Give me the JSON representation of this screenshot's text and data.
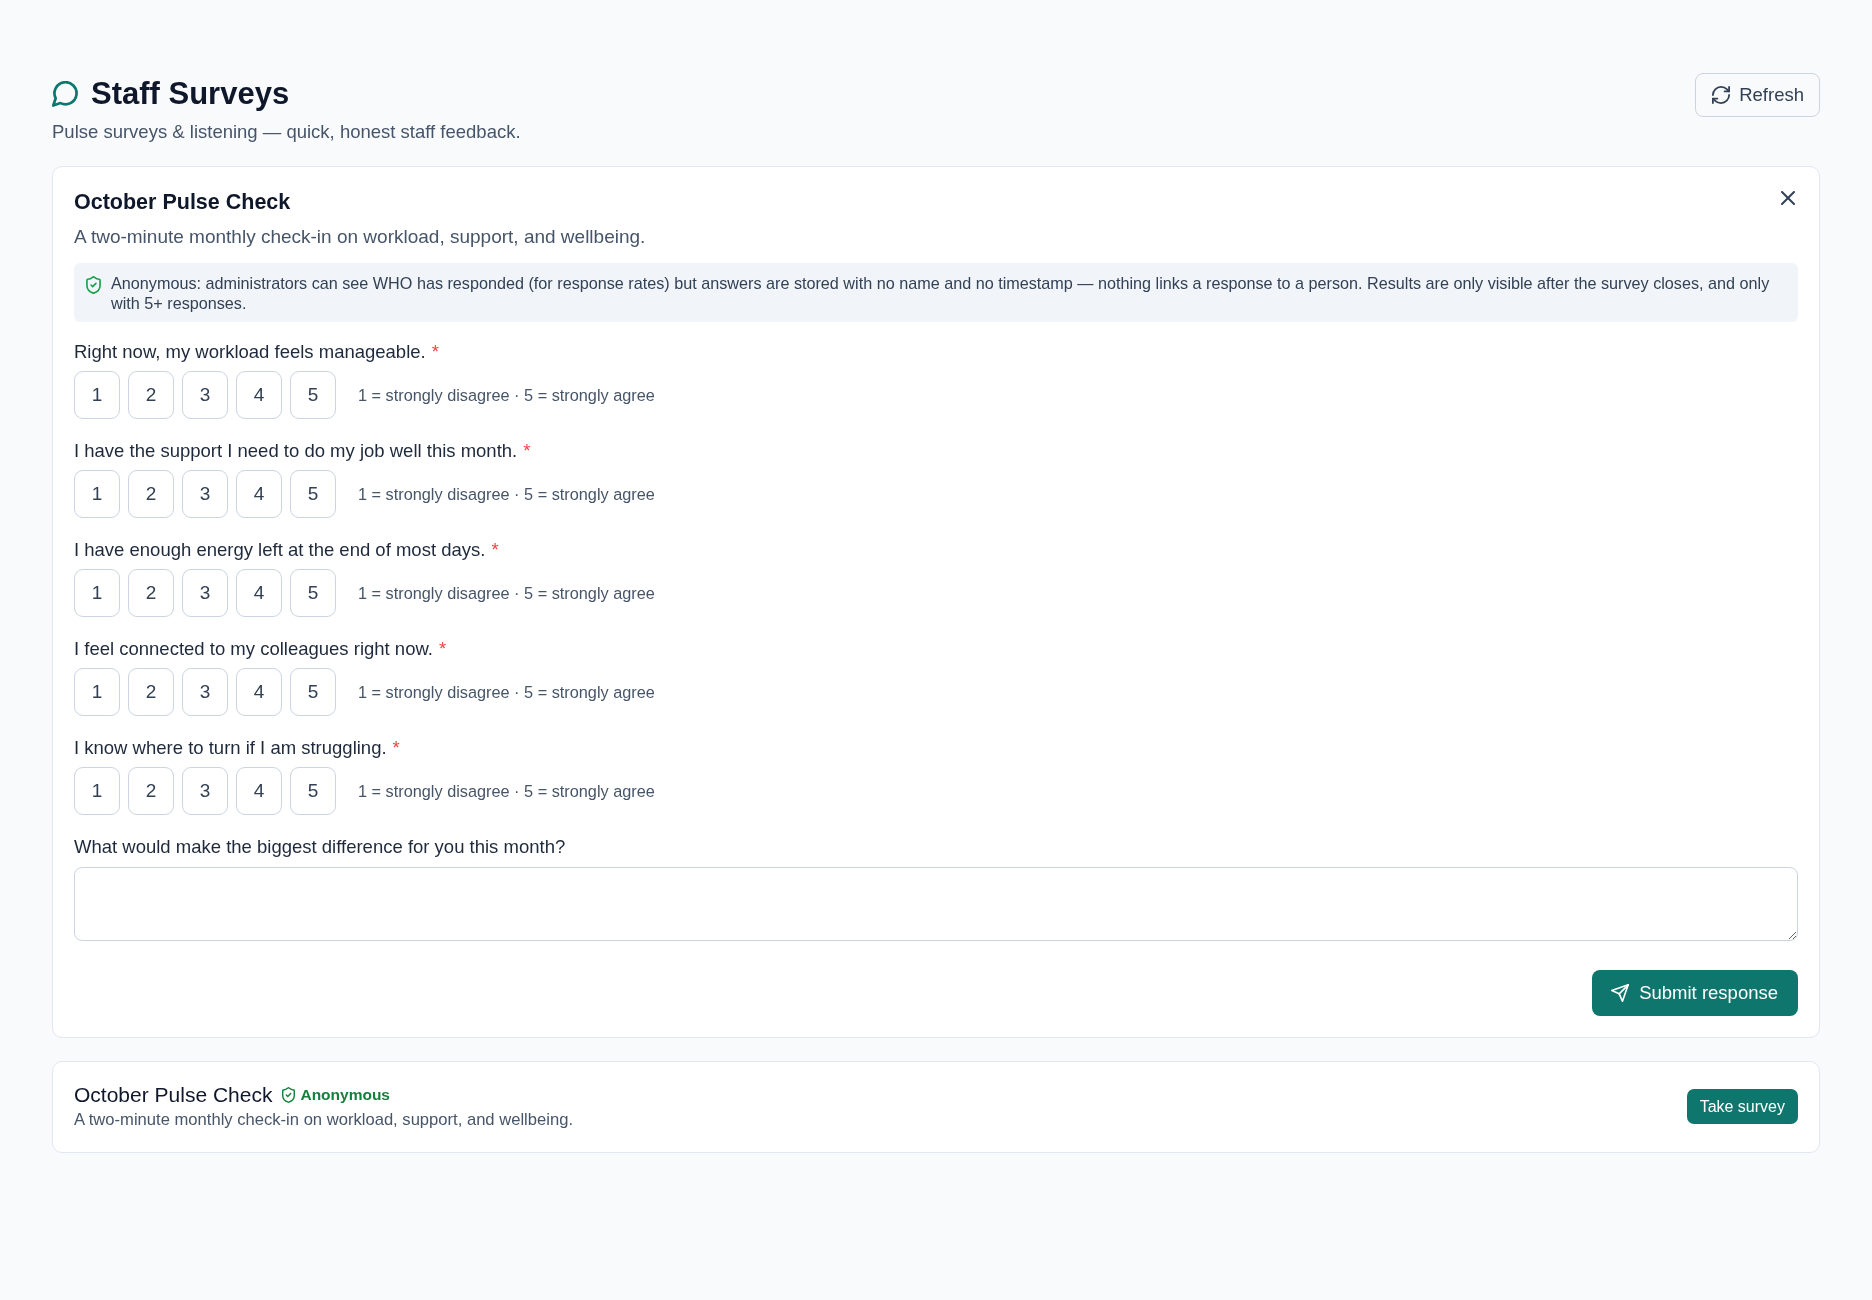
{
  "header": {
    "title": "Staff Surveys",
    "subtitle": "Pulse surveys & listening — quick, honest staff feedback.",
    "refresh_button": "Refresh"
  },
  "survey_form": {
    "title": "October Pulse Check",
    "description": "A two-minute monthly check-in on workload, support, and wellbeing.",
    "anonymity_notice": "Anonymous: administrators can see WHO has responded (for response rates) but answers are stored with no name and no timestamp — nothing links a response to a person. Results are only visible after the survey closes, and only with 5+ responses.",
    "questions": [
      {
        "kind": "rating",
        "prompt": "Right now, my workload feels manageable.",
        "required_mark": "*",
        "options": [
          {
            "label": "1",
            "selected": false
          },
          {
            "label": "2",
            "selected": false
          },
          {
            "label": "3",
            "selected": false
          },
          {
            "label": "4",
            "selected": false
          },
          {
            "label": "5",
            "selected": false
          }
        ],
        "scale_hint": "1 = strongly disagree · 5 = strongly agree"
      },
      {
        "kind": "rating",
        "prompt": "I have the support I need to do my job well this month.",
        "required_mark": "*",
        "options": [
          {
            "label": "1",
            "selected": false
          },
          {
            "label": "2",
            "selected": false
          },
          {
            "label": "3",
            "selected": false
          },
          {
            "label": "4",
            "selected": false
          },
          {
            "label": "5",
            "selected": false
          }
        ],
        "scale_hint": "1 = strongly disagree · 5 = strongly agree"
      },
      {
        "kind": "rating",
        "prompt": "I have enough energy left at the end of most days.",
        "required_mark": "*",
        "options": [
          {
            "label": "1",
            "selected": false
          },
          {
            "label": "2",
            "selected": false
          },
          {
            "label": "3",
            "selected": false
          },
          {
            "label": "4",
            "selected": false
          },
          {
            "label": "5",
            "selected": false
          }
        ],
        "scale_hint": "1 = strongly disagree · 5 = strongly agree"
      },
      {
        "kind": "rating",
        "prompt": "I feel connected to my colleagues right now.",
        "required_mark": "*",
        "options": [
          {
            "label": "1",
            "selected": false
          },
          {
            "label": "2",
            "selected": false
          },
          {
            "label": "3",
            "selected": false
          },
          {
            "label": "4",
            "selected": false
          },
          {
            "label": "5",
            "selected": false
          }
        ],
        "scale_hint": "1 = strongly disagree · 5 = strongly agree"
      },
      {
        "kind": "rating",
        "prompt": "I know where to turn if I am struggling.",
        "required_mark": "*",
        "options": [
          {
            "label": "1",
            "selected": false
          },
          {
            "label": "2",
            "selected": false
          },
          {
            "label": "3",
            "selected": false
          },
          {
            "label": "4",
            "selected": false
          },
          {
            "label": "5",
            "selected": false
          }
        ],
        "scale_hint": "1 = strongly disagree · 5 = strongly agree"
      },
      {
        "kind": "text",
        "prompt": "What would make the biggest difference for you this month?"
      }
    ],
    "submit_button": "Submit response"
  },
  "survey_list": [
    {
      "title": "October Pulse Check",
      "badge": "Anonymous",
      "description": "A two-minute monthly check-in on workload, support, and wellbeing.",
      "action_button": "Take survey"
    }
  ]
}
